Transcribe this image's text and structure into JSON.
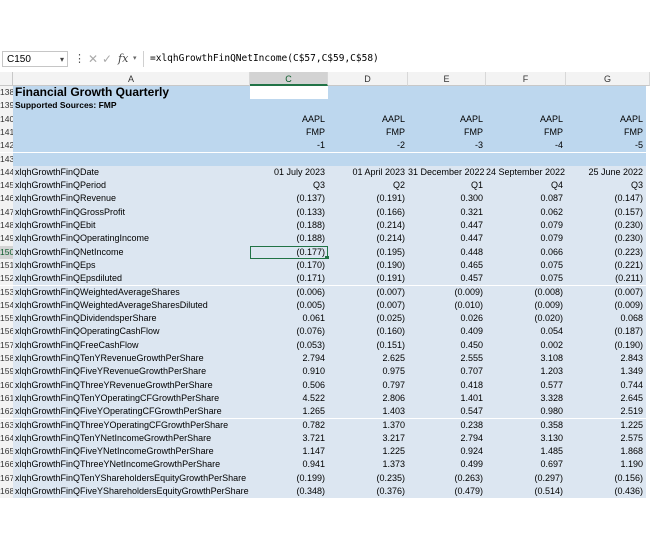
{
  "formula_bar": {
    "name_box": "C150",
    "vdots": "⋮",
    "cancel_glyph": "✕",
    "enter_glyph": "✓",
    "fx": "fx",
    "formula": "=xlqhGrowthFinQNetIncome(C$57,C$59,C$58)"
  },
  "columns": [
    "A",
    "C",
    "D",
    "E",
    "F",
    "G"
  ],
  "rows": [
    {
      "n": "138",
      "a": "Financial Growth Quarterly",
      "v": [
        "",
        "",
        "",
        "",
        ""
      ],
      "style": "title"
    },
    {
      "n": "139",
      "a": "Supported Sources: FMP",
      "v": [
        "",
        "",
        "",
        "",
        ""
      ],
      "style": "bold"
    },
    {
      "n": "140",
      "a": "",
      "v": [
        "AAPL",
        "AAPL",
        "AAPL",
        "AAPL",
        "AAPL"
      ],
      "style": "blue"
    },
    {
      "n": "141",
      "a": "",
      "v": [
        "FMP",
        "FMP",
        "FMP",
        "FMP",
        "FMP"
      ],
      "style": "blue"
    },
    {
      "n": "142",
      "a": "",
      "v": [
        "-1",
        "-2",
        "-3",
        "-4",
        "-5"
      ],
      "style": "blue"
    },
    {
      "n": "143",
      "a": "",
      "v": [
        "",
        "",
        "",
        "",
        ""
      ],
      "style": "blue"
    },
    {
      "n": "144",
      "a": "xlqhGrowthFinQDate",
      "v": [
        "01 July 2023",
        "01 April 2023",
        "31 December 2022",
        "24 September 2022",
        "25 June 2022"
      ],
      "style": "light"
    },
    {
      "n": "145",
      "a": "xlqhGrowthFinQPeriod",
      "v": [
        "Q3",
        "Q2",
        "Q1",
        "Q4",
        "Q3"
      ],
      "style": "light"
    },
    {
      "n": "146",
      "a": "xlqhGrowthFinQRevenue",
      "v": [
        "(0.137)",
        "(0.191)",
        "0.300",
        "0.087",
        "(0.147)"
      ],
      "style": "light"
    },
    {
      "n": "147",
      "a": "xlqhGrowthFinQGrossProfit",
      "v": [
        "(0.133)",
        "(0.166)",
        "0.321",
        "0.062",
        "(0.157)"
      ],
      "style": "light"
    },
    {
      "n": "148",
      "a": "xlqhGrowthFinQEbit",
      "v": [
        "(0.188)",
        "(0.214)",
        "0.447",
        "0.079",
        "(0.230)"
      ],
      "style": "light"
    },
    {
      "n": "149",
      "a": "xlqhGrowthFinQOperatingIncome",
      "v": [
        "(0.188)",
        "(0.214)",
        "0.447",
        "0.079",
        "(0.230)"
      ],
      "style": "light"
    },
    {
      "n": "150",
      "a": "xlqhGrowthFinQNetIncome",
      "v": [
        "(0.177)",
        "(0.195)",
        "0.448",
        "0.066",
        "(0.223)"
      ],
      "style": "light"
    },
    {
      "n": "151",
      "a": "xlqhGrowthFinQEps",
      "v": [
        "(0.170)",
        "(0.190)",
        "0.465",
        "0.075",
        "(0.221)"
      ],
      "style": "light"
    },
    {
      "n": "152",
      "a": "xlqhGrowthFinQEpsdiluted",
      "v": [
        "(0.171)",
        "(0.191)",
        "0.457",
        "0.075",
        "(0.211)"
      ],
      "style": "light"
    },
    {
      "n": "153",
      "a": "xlqhGrowthFinQWeightedAverageShares",
      "v": [
        "(0.006)",
        "(0.007)",
        "(0.009)",
        "(0.008)",
        "(0.007)"
      ],
      "style": "light"
    },
    {
      "n": "154",
      "a": "xlqhGrowthFinQWeightedAverageSharesDiluted",
      "v": [
        "(0.005)",
        "(0.007)",
        "(0.010)",
        "(0.009)",
        "(0.009)"
      ],
      "style": "light"
    },
    {
      "n": "155",
      "a": "xlqhGrowthFinQDividendsperShare",
      "v": [
        "0.061",
        "(0.025)",
        "0.026",
        "(0.020)",
        "0.068"
      ],
      "style": "light"
    },
    {
      "n": "156",
      "a": "xlqhGrowthFinQOperatingCashFlow",
      "v": [
        "(0.076)",
        "(0.160)",
        "0.409",
        "0.054",
        "(0.187)"
      ],
      "style": "light"
    },
    {
      "n": "157",
      "a": "xlqhGrowthFinQFreeCashFlow",
      "v": [
        "(0.053)",
        "(0.151)",
        "0.450",
        "0.002",
        "(0.190)"
      ],
      "style": "light"
    },
    {
      "n": "158",
      "a": "xlqhGrowthFinQTenYRevenueGrowthPerShare",
      "v": [
        "2.794",
        "2.625",
        "2.555",
        "3.108",
        "2.843"
      ],
      "style": "light"
    },
    {
      "n": "159",
      "a": "xlqhGrowthFinQFiveYRevenueGrowthPerShare",
      "v": [
        "0.910",
        "0.975",
        "0.707",
        "1.203",
        "1.349"
      ],
      "style": "light"
    },
    {
      "n": "160",
      "a": "xlqhGrowthFinQThreeYRevenueGrowthPerShare",
      "v": [
        "0.506",
        "0.797",
        "0.418",
        "0.577",
        "0.744"
      ],
      "style": "light"
    },
    {
      "n": "161",
      "a": "xlqhGrowthFinQTenYOperatingCFGrowthPerShare",
      "v": [
        "4.522",
        "2.806",
        "1.401",
        "3.328",
        "2.645"
      ],
      "style": "light"
    },
    {
      "n": "162",
      "a": "xlqhGrowthFinQFiveYOperatingCFGrowthPerShare",
      "v": [
        "1.265",
        "1.403",
        "0.547",
        "0.980",
        "2.519"
      ],
      "style": "light"
    },
    {
      "n": "163",
      "a": "xlqhGrowthFinQThreeYOperatingCFGrowthPerShare",
      "v": [
        "0.782",
        "1.370",
        "0.238",
        "0.358",
        "1.225"
      ],
      "style": "light"
    },
    {
      "n": "164",
      "a": "xlqhGrowthFinQTenYNetIncomeGrowthPerShare",
      "v": [
        "3.721",
        "3.217",
        "2.794",
        "3.130",
        "2.575"
      ],
      "style": "light"
    },
    {
      "n": "165",
      "a": "xlqhGrowthFinQFiveYNetIncomeGrowthPerShare",
      "v": [
        "1.147",
        "1.225",
        "0.924",
        "1.485",
        "1.868"
      ],
      "style": "light"
    },
    {
      "n": "166",
      "a": "xlqhGrowthFinQThreeYNetIncomeGrowthPerShare",
      "v": [
        "0.941",
        "1.373",
        "0.499",
        "0.697",
        "1.190"
      ],
      "style": "light"
    },
    {
      "n": "167",
      "a": "xlqhGrowthFinQTenYShareholdersEquityGrowthPerShare",
      "v": [
        "(0.199)",
        "(0.235)",
        "(0.263)",
        "(0.297)",
        "(0.156)"
      ],
      "style": "light"
    },
    {
      "n": "168",
      "a": "xlqhGrowthFinQFiveYShareholdersEquityGrowthPerShare",
      "v": [
        "(0.348)",
        "(0.376)",
        "(0.479)",
        "(0.514)",
        "(0.436)"
      ],
      "style": "light"
    },
    {
      "n": "169",
      "a": "",
      "v": [
        "",
        "",
        "",
        "",
        ""
      ],
      "style": "light"
    }
  ],
  "selected_row": "150",
  "selected_col": "C"
}
